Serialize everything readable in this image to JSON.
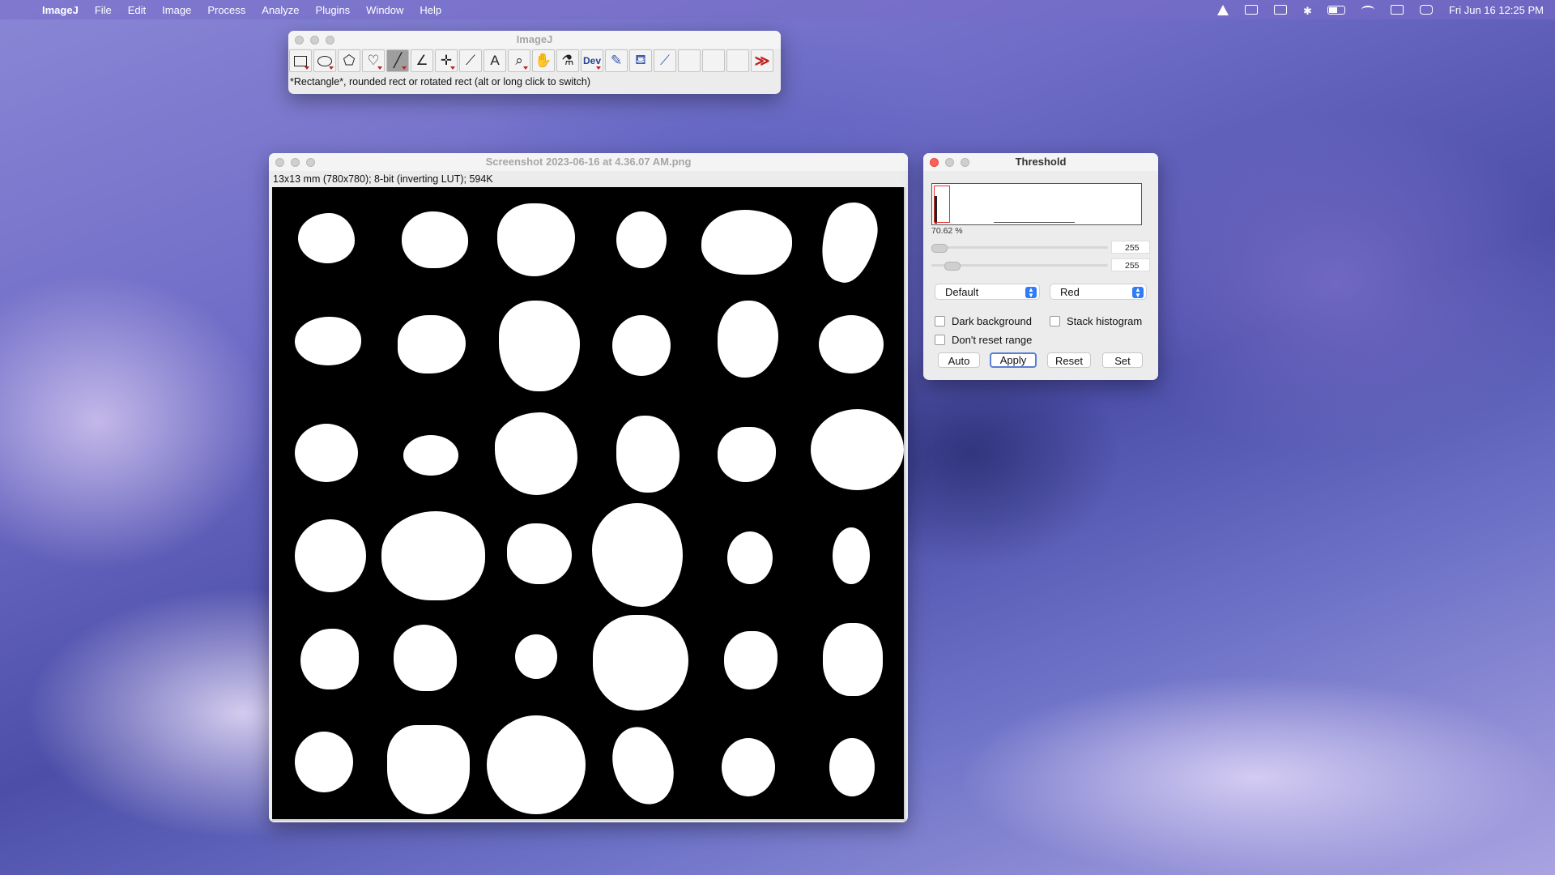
{
  "menubar": {
    "apple": "",
    "items": [
      "ImageJ",
      "File",
      "Edit",
      "Image",
      "Process",
      "Analyze",
      "Plugins",
      "Window",
      "Help"
    ],
    "clock": "Fri Jun 16  12:25 PM"
  },
  "toolbar_window": {
    "title": "ImageJ",
    "tools": [
      "rectangle-tool",
      "oval-tool",
      "polygon-tool",
      "freehand-tool",
      "line-tool",
      "angle-tool",
      "point-tool",
      "wand-tool",
      "text-tool",
      "zoom-tool",
      "hand-tool",
      "color-picker-tool",
      "dev-tool",
      "brush-tool",
      "flood-fill-tool",
      "pipette-tool",
      "empty-slot",
      "empty-slot",
      "empty-slot",
      "more-tools"
    ],
    "active_tool": "line-tool",
    "dev_label": "Dev",
    "more_label": "≫",
    "status": "*Rectangle*, rounded rect or rotated rect (alt or long click to switch)"
  },
  "image_window": {
    "title": "Screenshot 2023-06-16 at 4.36.07 AM.png",
    "info": "13x13 mm (780x780); 8-bit (inverting LUT); 594K"
  },
  "threshold_window": {
    "title": "Threshold",
    "percent": "70.62 %",
    "min_value": "255",
    "max_value": "255",
    "method": "Default",
    "display": "Red",
    "dark_background_label": "Dark background",
    "stack_histogram_label": "Stack histogram",
    "dont_reset_label": "Don't reset range",
    "buttons": {
      "auto": "Auto",
      "apply": "Apply",
      "reset": "Reset",
      "set": "Set"
    },
    "accent_color": "#2f7cf6",
    "threshold_color": "#e03030"
  }
}
